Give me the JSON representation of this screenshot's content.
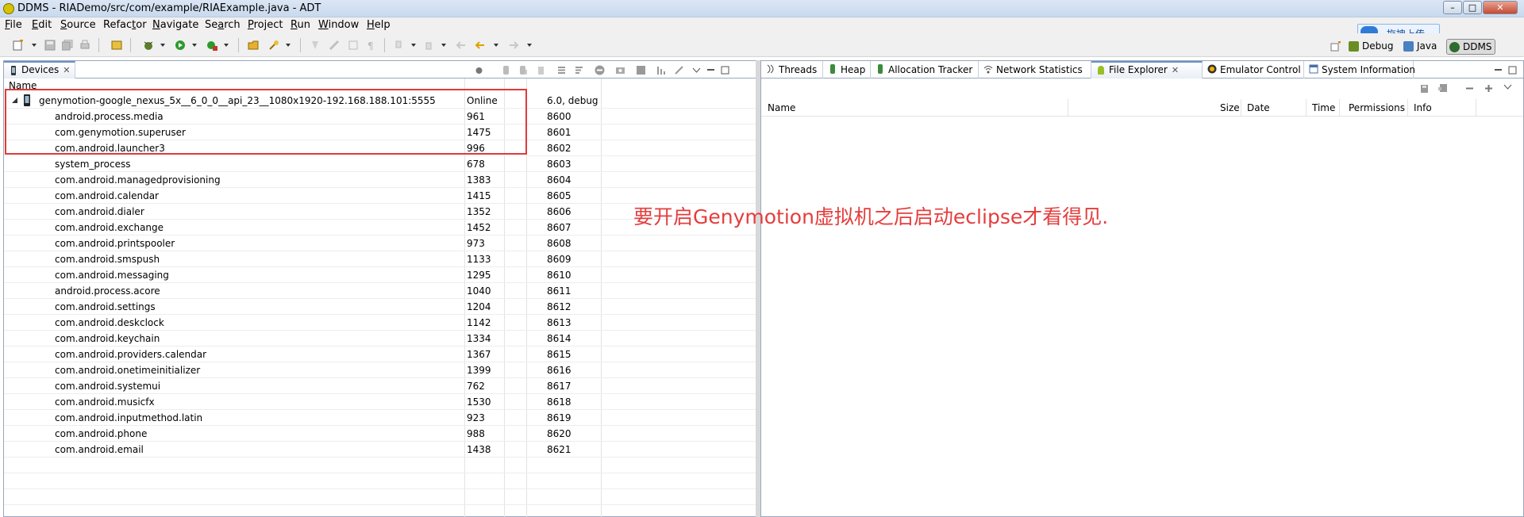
{
  "window": {
    "title": "DDMS - RIADemo/src/com/example/RIAExample.java - ADT",
    "minimize": "–",
    "maximize": "□",
    "close": "✕"
  },
  "upload_button": {
    "label": "拖拽上传"
  },
  "menu": [
    {
      "mnemonic": "F",
      "rest": "ile"
    },
    {
      "mnemonic": "E",
      "rest": "dit"
    },
    {
      "mnemonic": "S",
      "rest": "ource"
    },
    {
      "mnemonic": "",
      "rest": "Refac",
      "mnemonic2": "t",
      "rest2": "or"
    },
    {
      "mnemonic": "N",
      "rest": "avigate"
    },
    {
      "mnemonic": "",
      "rest": "Se",
      "mnemonic2": "a",
      "rest2": "rch"
    },
    {
      "mnemonic": "P",
      "rest": "roject"
    },
    {
      "mnemonic": "R",
      "rest": "un"
    },
    {
      "mnemonic": "W",
      "rest": "indow"
    },
    {
      "mnemonic": "H",
      "rest": "elp"
    }
  ],
  "perspectives": [
    {
      "label": "Debug",
      "color": "#6b8e23"
    },
    {
      "label": "Java",
      "color": "#4a7fc1"
    },
    {
      "label": "DDMS",
      "color": "#2e6b2e"
    }
  ],
  "devices_view": {
    "tab_label": "Devices",
    "tab_close": "✕",
    "columns": [
      "Name"
    ],
    "device": {
      "name": "genymotion-google_nexus_5x__6_0_0__api_23__1080x1920-192.168.188.101:5555",
      "status": "Online",
      "version": "6.0, debug"
    },
    "processes": [
      {
        "name": "android.process.media",
        "pid": "961",
        "port": "8600"
      },
      {
        "name": "com.genymotion.superuser",
        "pid": "1475",
        "port": "8601"
      },
      {
        "name": "com.android.launcher3",
        "pid": "996",
        "port": "8602"
      },
      {
        "name": "system_process",
        "pid": "678",
        "port": "8603"
      },
      {
        "name": "com.android.managedprovisioning",
        "pid": "1383",
        "port": "8604"
      },
      {
        "name": "com.android.calendar",
        "pid": "1415",
        "port": "8605"
      },
      {
        "name": "com.android.dialer",
        "pid": "1352",
        "port": "8606"
      },
      {
        "name": "com.android.exchange",
        "pid": "1452",
        "port": "8607"
      },
      {
        "name": "com.android.printspooler",
        "pid": "973",
        "port": "8608"
      },
      {
        "name": "com.android.smspush",
        "pid": "1133",
        "port": "8609"
      },
      {
        "name": "com.android.messaging",
        "pid": "1295",
        "port": "8610"
      },
      {
        "name": "android.process.acore",
        "pid": "1040",
        "port": "8611"
      },
      {
        "name": "com.android.settings",
        "pid": "1204",
        "port": "8612"
      },
      {
        "name": "com.android.deskclock",
        "pid": "1142",
        "port": "8613"
      },
      {
        "name": "com.android.keychain",
        "pid": "1334",
        "port": "8614"
      },
      {
        "name": "com.android.providers.calendar",
        "pid": "1367",
        "port": "8615"
      },
      {
        "name": "com.android.onetimeinitializer",
        "pid": "1399",
        "port": "8616"
      },
      {
        "name": "com.android.systemui",
        "pid": "762",
        "port": "8617"
      },
      {
        "name": "com.android.musicfx",
        "pid": "1530",
        "port": "8618"
      },
      {
        "name": "com.android.inputmethod.latin",
        "pid": "923",
        "port": "8619"
      },
      {
        "name": "com.android.phone",
        "pid": "988",
        "port": "8620"
      },
      {
        "name": "com.android.email",
        "pid": "1438",
        "port": "8621"
      }
    ]
  },
  "right_tabs": [
    {
      "label": "Threads",
      "icon": "threads-icon"
    },
    {
      "label": "Heap",
      "icon": "heap-icon"
    },
    {
      "label": "Allocation Tracker",
      "icon": "allocation-icon"
    },
    {
      "label": "Network Statistics",
      "icon": "network-icon"
    },
    {
      "label": "File Explorer",
      "icon": "android-icon",
      "close": "✕"
    },
    {
      "label": "Emulator Control",
      "icon": "emulator-icon"
    },
    {
      "label": "System Information",
      "icon": "sysinfo-icon"
    }
  ],
  "file_explorer": {
    "columns": [
      "Name",
      "Size",
      "Date",
      "Time",
      "Permissions",
      "Info"
    ]
  },
  "annotation": {
    "text": "要开启Genymotion虚拟机之后启动eclipse才看得见."
  }
}
